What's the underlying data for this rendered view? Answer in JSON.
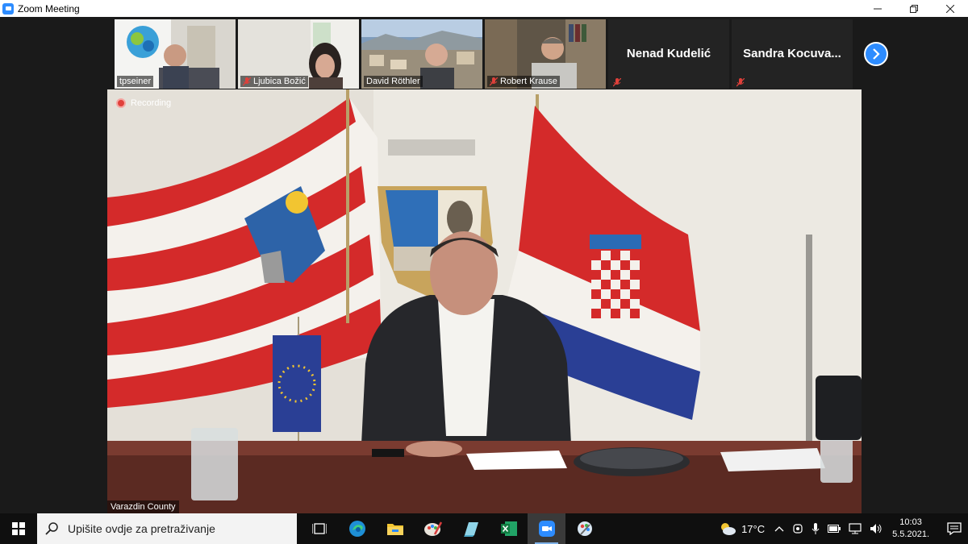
{
  "window": {
    "title": "Zoom Meeting"
  },
  "participants": [
    {
      "name": "tpseiner",
      "muted": false
    },
    {
      "name": "Ljubica Božić",
      "muted": true
    },
    {
      "name": "David Röthler",
      "muted": false
    },
    {
      "name": "Robert Krause",
      "muted": true
    },
    {
      "name": "Nenad Kudelić",
      "muted": true
    },
    {
      "name": "Sandra  Kocuva...",
      "muted": true
    }
  ],
  "main_video": {
    "recording_label": "Recording",
    "speaker_name": "Varazdin County"
  },
  "taskbar": {
    "search_placeholder": "Upišite ovdje za pretraživanje",
    "weather": {
      "temp": "17°C",
      "icon": "partly-cloudy-icon"
    },
    "clock": {
      "time": "10:03",
      "date": "5.5.2021."
    },
    "apps": [
      "task-view-icon",
      "edge-icon",
      "file-explorer-icon",
      "paint-icon",
      "notes-icon",
      "excel-icon",
      "zoom-icon",
      "settings-app-icon"
    ]
  },
  "colors": {
    "zoom_blue": "#2d8cff",
    "recording_red": "#e0403a"
  }
}
